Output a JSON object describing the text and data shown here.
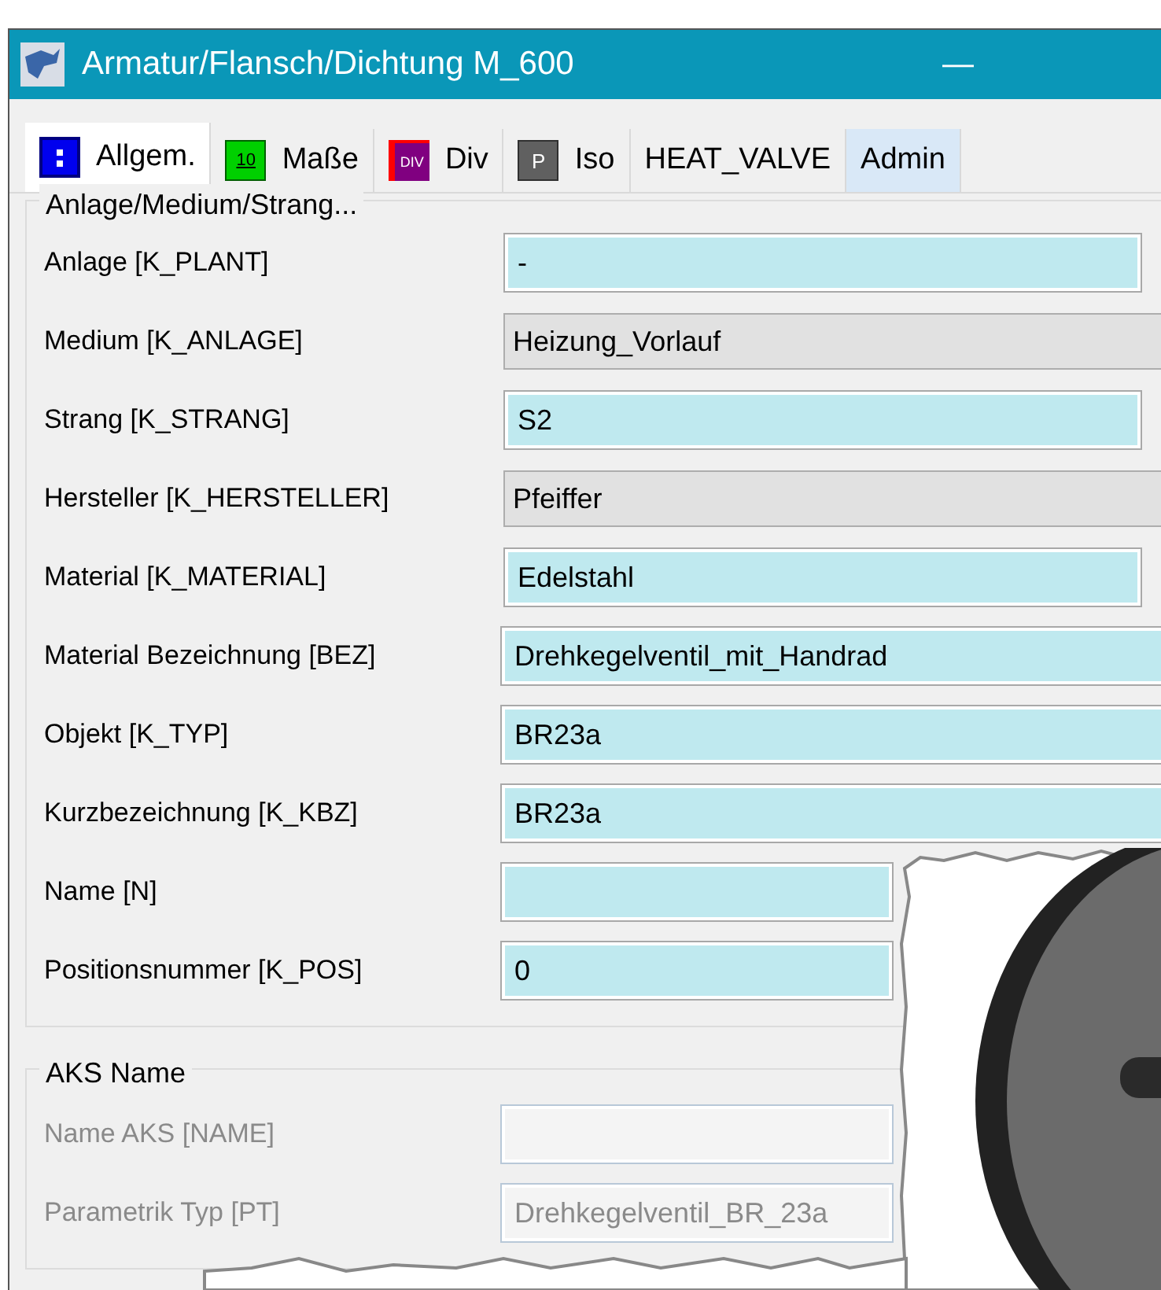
{
  "window": {
    "title": "Armatur/Flansch/Dichtung M_600",
    "minimize": "—"
  },
  "tabs": [
    {
      "label": "Allgem.",
      "kind": "grid",
      "selected": true
    },
    {
      "label": "Maße",
      "kind": "green",
      "icon_text": "10",
      "selected": false
    },
    {
      "label": "Div",
      "kind": "div",
      "icon_text": "DIV",
      "selected": false
    },
    {
      "label": "Iso",
      "kind": "gray",
      "icon_text": "P",
      "selected": false
    },
    {
      "label": "HEAT_VALVE",
      "kind": "none",
      "selected": false
    },
    {
      "label": "Admin",
      "kind": "none",
      "selected": false
    }
  ],
  "groups": [
    {
      "title": "Anlage/Medium/Strang...",
      "fields": [
        {
          "label": "Anlage [K_PLANT]",
          "value": "-",
          "kind": "lookup",
          "disabled": false
        },
        {
          "label": "Medium [K_ANLAGE]",
          "value": "Heizung_Vorlauf",
          "kind": "combo",
          "disabled": false
        },
        {
          "label": "Strang [K_STRANG]",
          "value": "S2",
          "kind": "lookup",
          "disabled": false
        },
        {
          "label": "Hersteller [K_HERSTELLER]",
          "value": "Pfeiffer",
          "kind": "combo",
          "disabled": false
        },
        {
          "label": "Material [K_MATERIAL]",
          "value": "Edelstahl",
          "kind": "lookup",
          "disabled": false
        },
        {
          "label": "Material Bezeichnung [BEZ]",
          "value": "Drehkegelventil_mit_Handrad",
          "kind": "text",
          "disabled": false
        },
        {
          "label": "Objekt [K_TYP]",
          "value": "BR23a",
          "kind": "text",
          "disabled": false
        },
        {
          "label": "Kurzbezeichnung [K_KBZ]",
          "value": "BR23a",
          "kind": "text",
          "disabled": false
        },
        {
          "label": "Name [N]",
          "kind": "text",
          "disabled": false
        },
        {
          "label": "Positionsnummer [K_POS]",
          "value": "0",
          "kind": "text",
          "disabled": false
        }
      ]
    },
    {
      "title": "AKS Name",
      "fields": [
        {
          "label": "Name AKS [NAME]",
          "kind": "text",
          "disabled": true
        },
        {
          "label": "Parametrik Typ [PT]",
          "value": "Drehkegelventil_BR_23a",
          "kind": "text",
          "disabled": true
        }
      ]
    }
  ]
}
